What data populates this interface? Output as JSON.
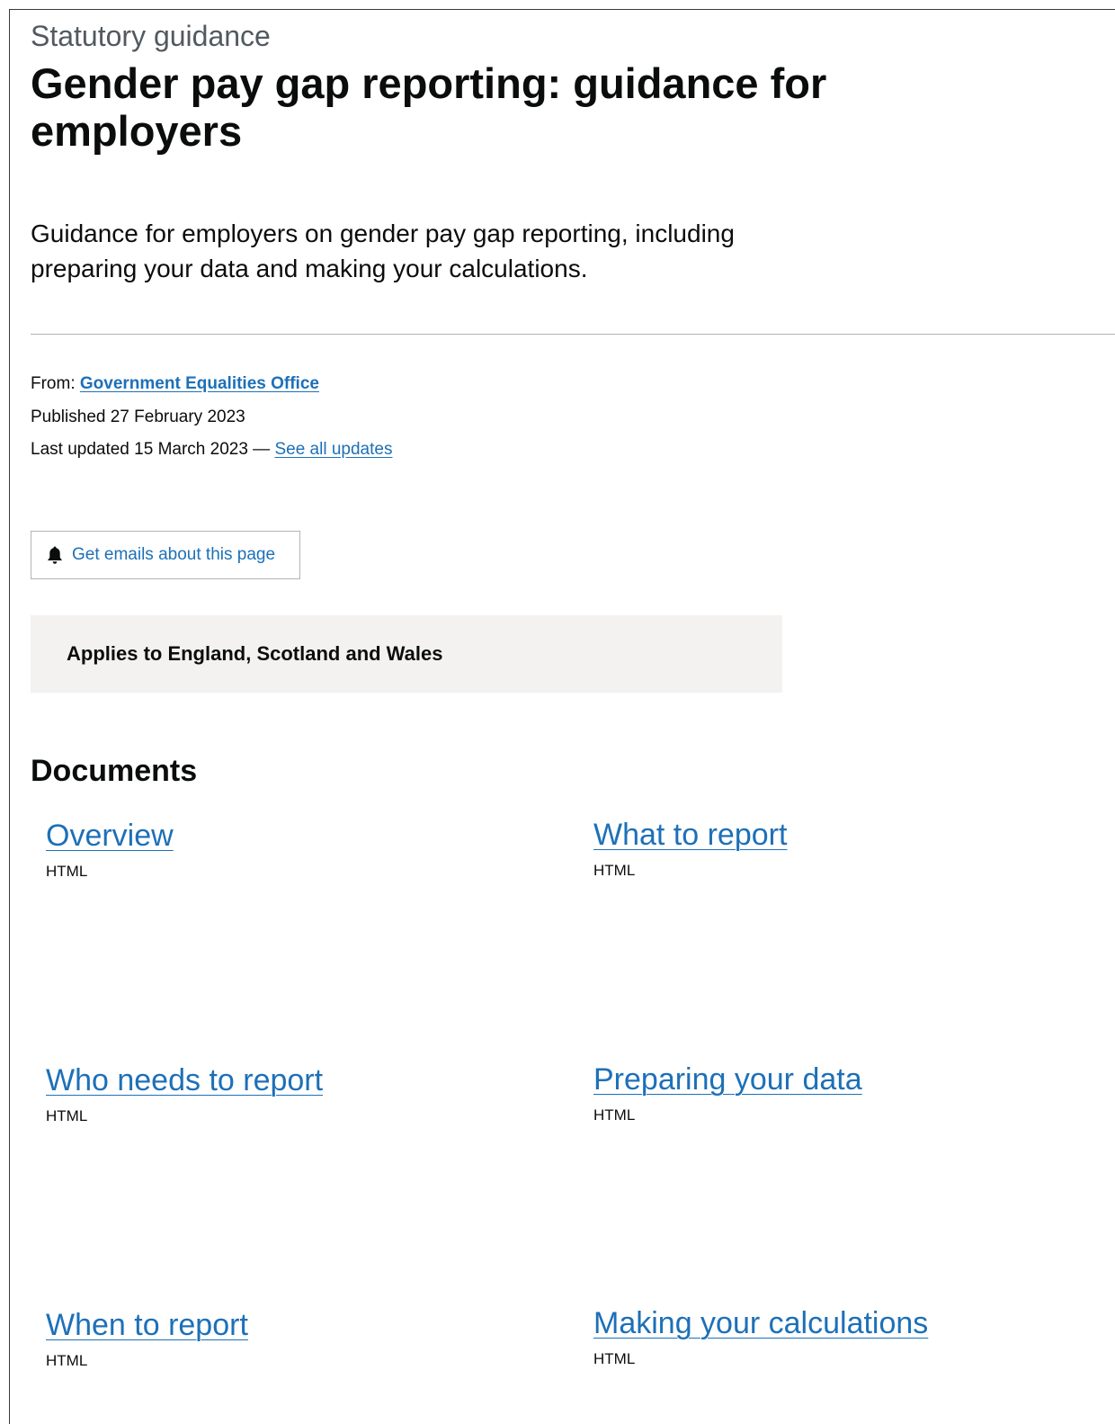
{
  "header": {
    "document_type": "Statutory guidance",
    "title": "Gender pay gap reporting: guidance for employers",
    "summary": "Guidance for employers on gender pay gap reporting, including preparing your data and making your calculations."
  },
  "metadata": {
    "from_label": "From:",
    "organisation": "Government Equalities Office",
    "published": "Published 27 February 2023",
    "last_updated": "Last updated 15 March 2023 —",
    "see_all_updates": "See all updates"
  },
  "email_signup": {
    "label": "Get emails about this page",
    "icon": "bell-icon"
  },
  "applies_to": "Applies to England, Scotland and Wales",
  "documents": {
    "heading": "Documents",
    "items": [
      {
        "title": "Overview",
        "format": "HTML"
      },
      {
        "title": "What to report",
        "format": "HTML"
      },
      {
        "title": "Who needs to report",
        "format": "HTML"
      },
      {
        "title": "Preparing your data",
        "format": "HTML"
      },
      {
        "title": "When to report",
        "format": "HTML"
      },
      {
        "title": "Making your calculations",
        "format": "HTML"
      }
    ]
  },
  "colors": {
    "link": "#1d70b8",
    "text": "#0b0c0c",
    "secondary_text": "#505a5f",
    "inset_background": "#f3f2f1",
    "border": "#b1b4b6"
  }
}
